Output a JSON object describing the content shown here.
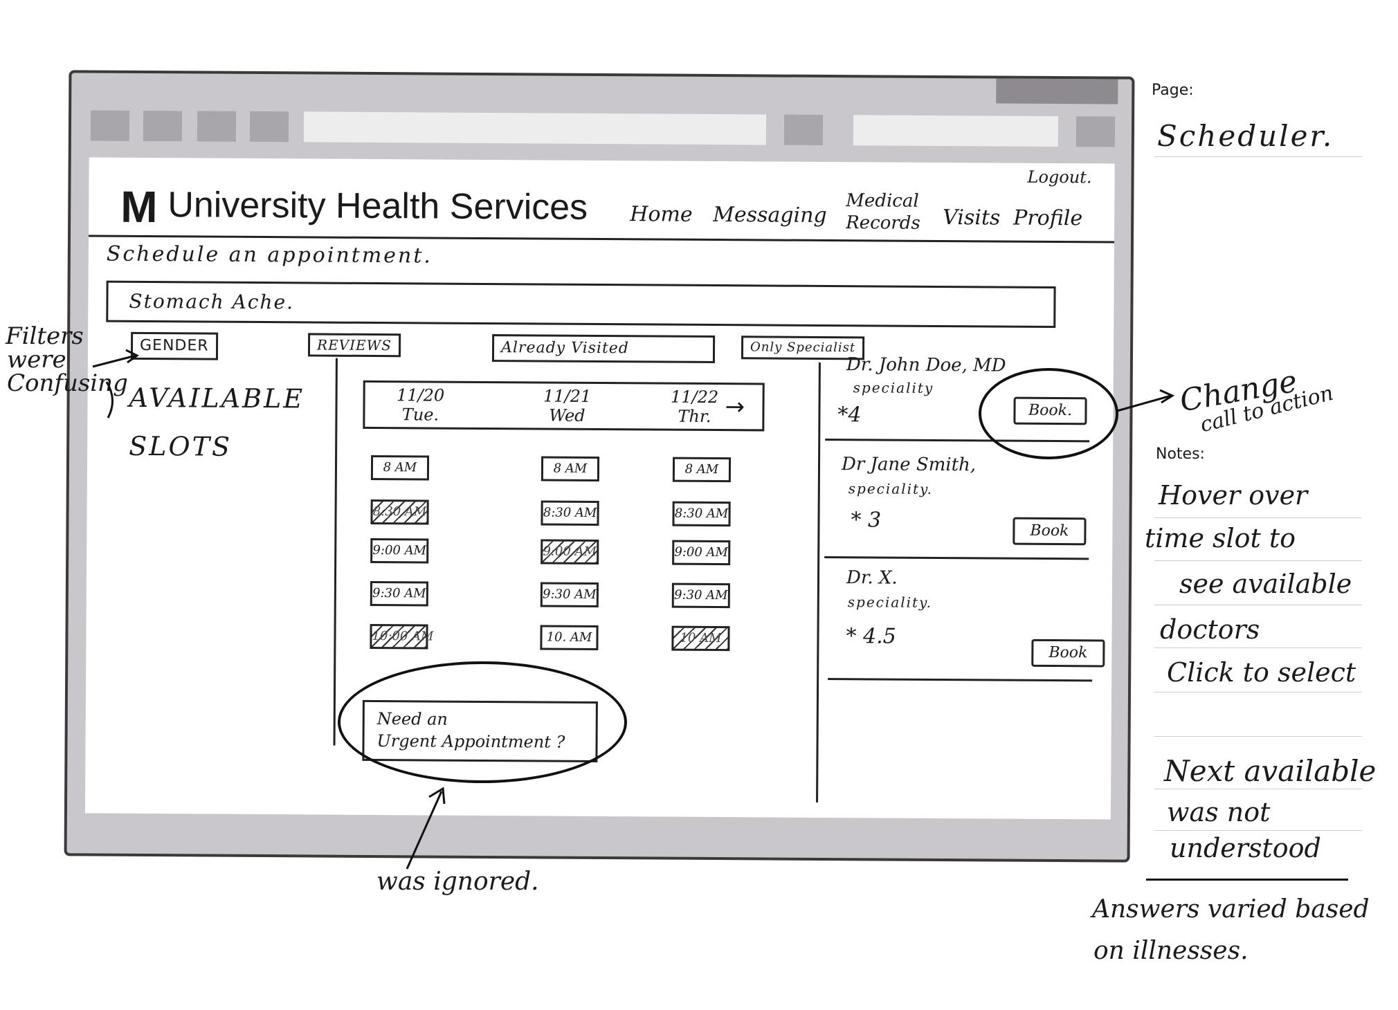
{
  "sheet": {
    "page_label": "Page:",
    "page_value": "Scheduler.",
    "notes_label": "Notes:"
  },
  "header": {
    "logo": "M",
    "title": "University Health Services",
    "logout": "Logout.",
    "nav": [
      "Home",
      "Messaging",
      "Medical Records",
      "Visits",
      "Profile"
    ]
  },
  "main": {
    "heading": "Schedule an appointment.",
    "search_value": "Stomach Ache.",
    "filters": [
      "GENDER",
      "REVIEWS",
      "Already Visited",
      "Only Specialist"
    ],
    "available_slots": "AVAILABLE SLOTS"
  },
  "calendar": {
    "days": [
      {
        "date": "11/20",
        "day": "Tue."
      },
      {
        "date": "11/21",
        "day": "Wed"
      },
      {
        "date": "11/22",
        "day": "Thr."
      }
    ],
    "next_arrow": "→",
    "slots": [
      [
        {
          "t": "8 AM",
          "u": false
        },
        {
          "t": "8:30 AM",
          "u": true
        },
        {
          "t": "9:00 AM",
          "u": false
        },
        {
          "t": "9:30 AM",
          "u": false
        },
        {
          "t": "10:00 AM",
          "u": true
        }
      ],
      [
        {
          "t": "8 AM",
          "u": false
        },
        {
          "t": "8:30 AM",
          "u": false
        },
        {
          "t": "9:00 AM",
          "u": true
        },
        {
          "t": "9:30 AM",
          "u": false
        },
        {
          "t": "10. AM",
          "u": false
        }
      ],
      [
        {
          "t": "8 AM",
          "u": false
        },
        {
          "t": "8:30 AM",
          "u": false
        },
        {
          "t": "9:00 AM",
          "u": false
        },
        {
          "t": "9:30 AM",
          "u": false
        },
        {
          "t": "10 AM",
          "u": true
        }
      ]
    ],
    "urgent_line1": "Need an",
    "urgent_line2": "Urgent Appointment ?"
  },
  "doctors": [
    {
      "name": "Dr. John Doe, MD",
      "speciality": "speciality",
      "rating": "*4",
      "book": "Book."
    },
    {
      "name": "Dr Jane Smith,",
      "speciality": "speciality.",
      "rating": "* 3",
      "book": "Book"
    },
    {
      "name": "Dr. X.",
      "speciality": "speciality.",
      "rating": "* 4.5",
      "book": "Book"
    }
  ],
  "annotations": {
    "filters_note": [
      "Filters",
      "were",
      "Confusing"
    ],
    "change_note": [
      "Change",
      "call to action"
    ],
    "ignored_note": "was ignored.",
    "notes": [
      "Hover over",
      "time slot to",
      "see available",
      "doctors",
      "Click to select",
      "Next available",
      "was not",
      "understood",
      "Answers varied based",
      "on illnesses."
    ]
  }
}
